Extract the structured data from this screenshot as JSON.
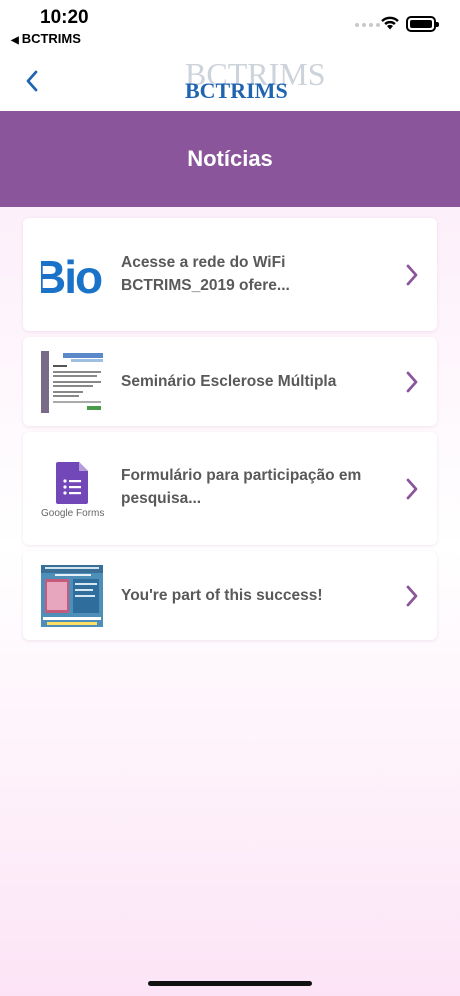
{
  "status_bar": {
    "time": "10:20",
    "back_app_label": "BCTRIMS",
    "back_arrow_glyph": "◀"
  },
  "navbar": {
    "logo_text": "BCTRIMS",
    "logo_shadow_text": "BCTRIMS"
  },
  "header": {
    "title": "Notícias"
  },
  "news": [
    {
      "title": "Acesse a rede do WiFi BCTRIMS_2019 ofere...",
      "thumb": "blog-icon",
      "thumb_text": "Biog"
    },
    {
      "title": "Seminário Esclerose Múltipla",
      "thumb": "document-thumbnail"
    },
    {
      "title": "Formulário para participação em pesquisa...",
      "thumb": "google-forms-icon",
      "thumb_text": "Google Forms"
    },
    {
      "title": "You're part of this success!",
      "thumb": "poster-thumbnail"
    }
  ],
  "colors": {
    "accent": "#8a559a",
    "logo_blue": "#1f64b0",
    "chevron": "#8a559a"
  }
}
